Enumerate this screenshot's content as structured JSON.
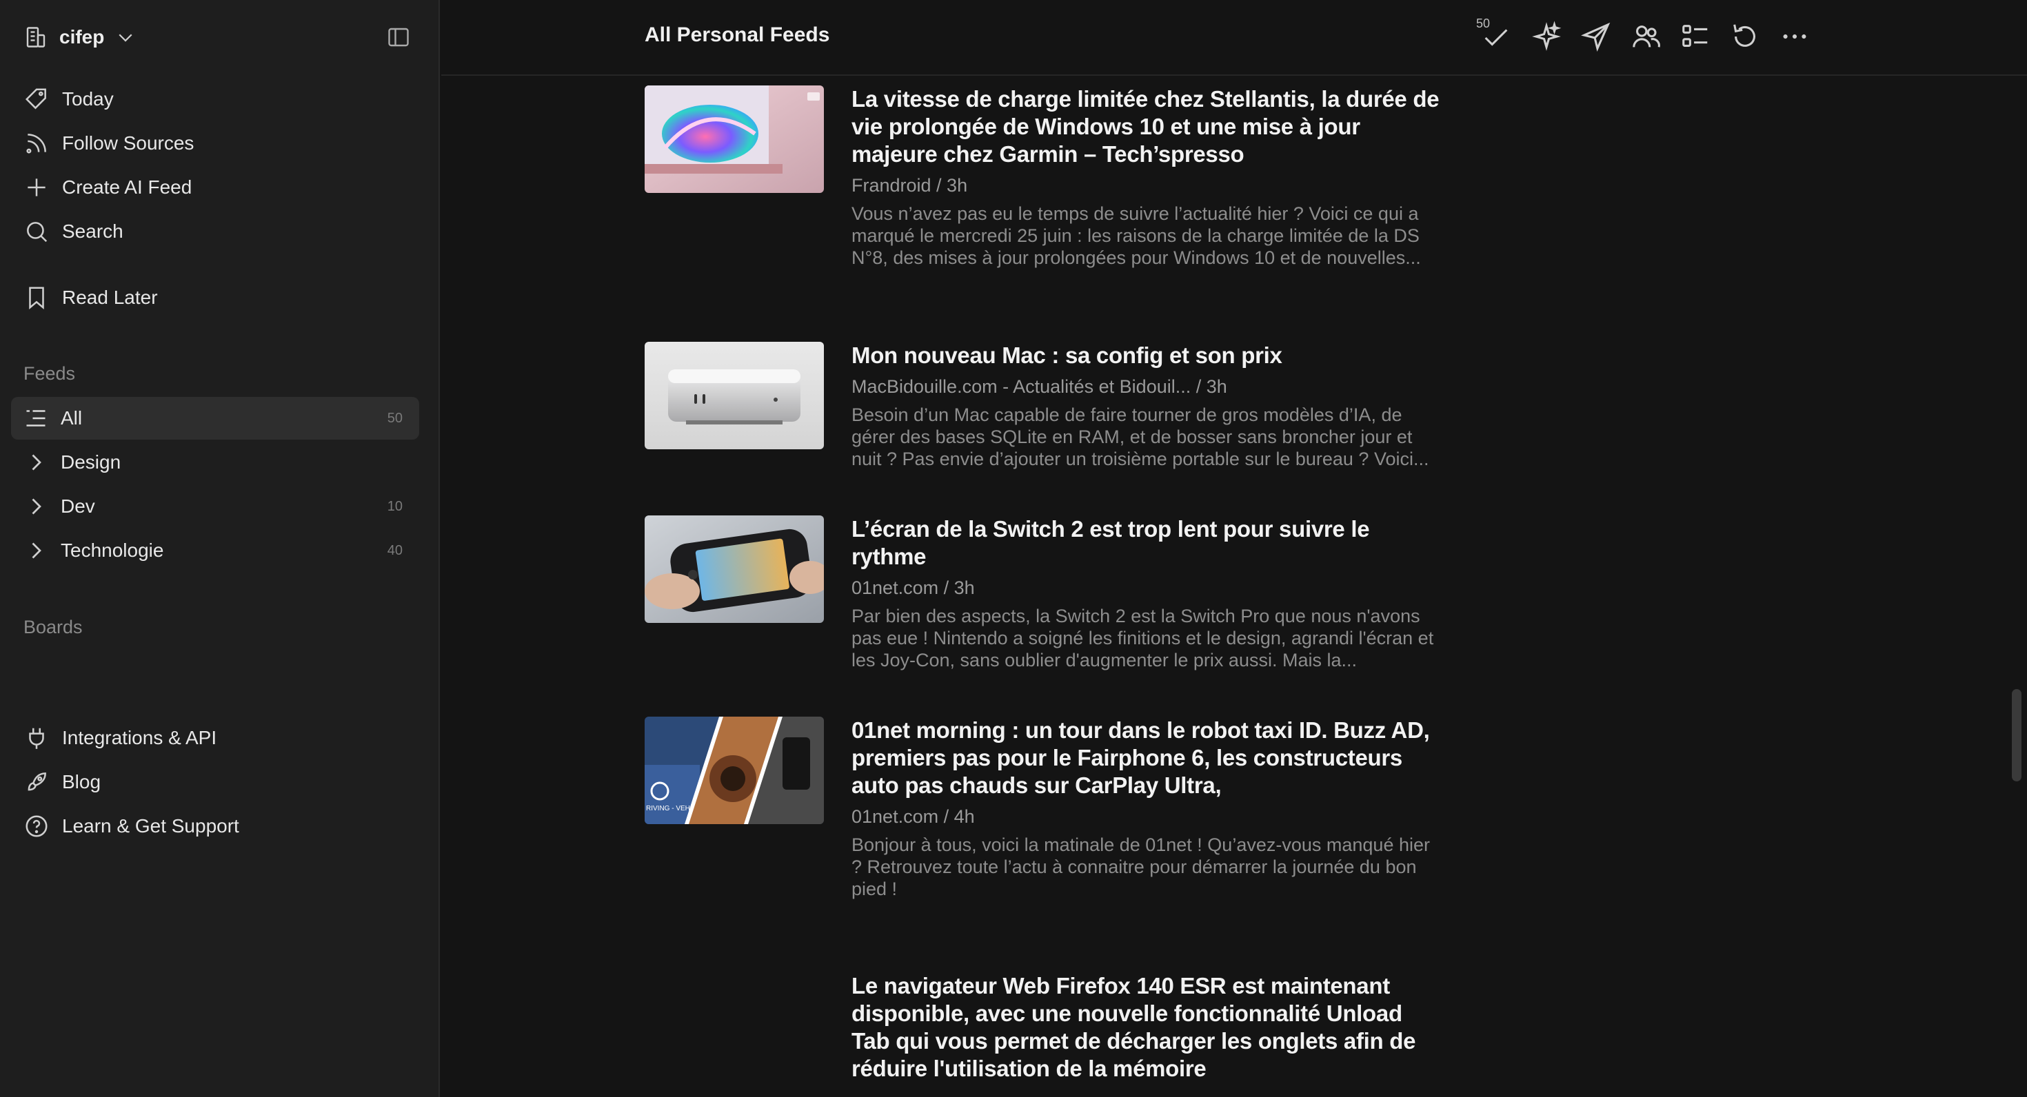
{
  "workspace": {
    "name": "cifep"
  },
  "nav": {
    "today": "Today",
    "follow_sources": "Follow Sources",
    "create_ai_feed": "Create AI Feed",
    "search": "Search",
    "read_later": "Read Later",
    "integrations": "Integrations & API",
    "blog": "Blog",
    "support": "Learn & Get Support"
  },
  "feeds": {
    "label": "Feeds",
    "items": [
      {
        "label": "All",
        "count": "50"
      },
      {
        "label": "Design",
        "count": ""
      },
      {
        "label": "Dev",
        "count": "10"
      },
      {
        "label": "Technologie",
        "count": "40"
      }
    ]
  },
  "boards": {
    "label": "Boards"
  },
  "header": {
    "title": "All Personal Feeds",
    "unread_badge": "50"
  },
  "articles": [
    {
      "title": "La vitesse de charge limitée chez Stellantis, la durée de vie prolongée de Windows 10 et une mise à jour majeure chez Garmin – Tech’spresso",
      "meta": "Frandroid / 3h",
      "summary": "Vous n’avez pas eu le temps de suivre l’actualité hier ? Voici ce qui a marqué le mercredi 25 juin : les raisons de la charge limitée de la DS N°8, des mises à jour prolongées pour Windows 10 et de nouvelles..."
    },
    {
      "title": "Mon nouveau Mac : sa config et son prix",
      "meta": "MacBidouille.com - Actualités et Bidouil... / 3h",
      "summary": "Besoin d’un Mac capable de faire tourner de gros modèles d’IA, de gérer des bases SQLite en RAM, et de bosser sans broncher jour et nuit ? Pas envie d’ajouter un troisième portable sur le bureau ? Voici..."
    },
    {
      "title": "L’écran de la Switch 2 est trop lent pour suivre le rythme",
      "meta": "01net.com / 3h",
      "summary": "Par bien des aspects, la Switch 2 est la Switch Pro que nous n'avons pas eue ! Nintendo a soigné les finitions et le design, agrandi l'écran et les Joy-Con, sans oublier d'augmenter le prix aussi. Mais la..."
    },
    {
      "title": "01net morning : un tour dans le robot taxi ID. Buzz AD, premiers pas pour le Fairphone 6, les constructeurs auto pas chauds sur CarPlay Ultra,",
      "meta": "01net.com / 4h",
      "summary": "Bonjour à tous, voici la matinale de 01net ! Qu’avez-vous manqué hier ? Retrouvez toute l’actu à connaitre pour démarrer la journée du bon pied !"
    },
    {
      "title": "Le navigateur Web Firefox 140 ESR est maintenant disponible, avec une nouvelle fonctionnalité Unload Tab qui vous permet de décharger les onglets afin de réduire l'utilisation de la mémoire",
      "meta": "",
      "summary": ""
    }
  ],
  "thumb_text": {
    "vw": "RIVING - VEH"
  }
}
